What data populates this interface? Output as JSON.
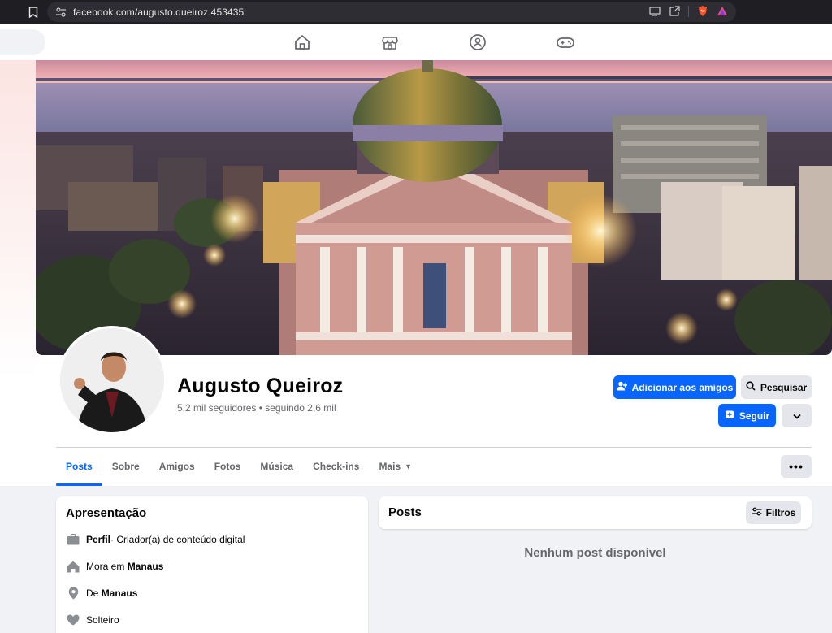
{
  "browser": {
    "url": "facebook.com/augusto.queiroz.453435"
  },
  "profile": {
    "name": "Augusto Queiroz",
    "stats": "5,2 mil seguidores • seguindo 2,6 mil",
    "actions": {
      "add_friend": "Adicionar aos amigos",
      "search": "Pesquisar",
      "follow": "Seguir"
    }
  },
  "tabs": [
    {
      "label": "Posts"
    },
    {
      "label": "Sobre"
    },
    {
      "label": "Amigos"
    },
    {
      "label": "Fotos"
    },
    {
      "label": "Música"
    },
    {
      "label": "Check-ins"
    },
    {
      "label": "Mais"
    }
  ],
  "more_button": "•••",
  "intro": {
    "title": "Apresentação",
    "items": [
      {
        "icon": "briefcase-icon",
        "label": "Perfil",
        "text": " · Criador(a) de conteúdo digital"
      },
      {
        "icon": "home-icon",
        "prefix": "Mora em ",
        "value": "Manaus"
      },
      {
        "icon": "location-icon",
        "prefix": "De ",
        "value": "Manaus"
      },
      {
        "icon": "heart-icon",
        "text": "Solteiro"
      }
    ]
  },
  "posts": {
    "title": "Posts",
    "filter": "Filtros",
    "empty": "Nenhum post disponível"
  },
  "colors": {
    "primary": "#0866ff",
    "secondary_bg": "#e4e6eb",
    "page_bg": "#f0f2f5"
  }
}
